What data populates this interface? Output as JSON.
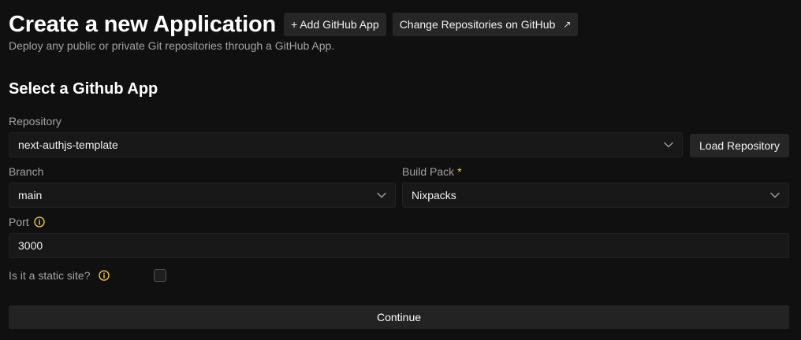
{
  "header": {
    "title": "Create a new Application",
    "add_github_app_label": "+ Add GitHub App",
    "change_repositories_label": "Change Repositories on GitHub",
    "external_link_icon": "↗",
    "subtitle": "Deploy any public or private Git repositories through a GitHub App."
  },
  "section": {
    "title": "Select a Github App"
  },
  "form": {
    "repository": {
      "label": "Repository",
      "value": "next-authjs-template"
    },
    "load_repository_label": "Load Repository",
    "branch": {
      "label": "Branch",
      "value": "main"
    },
    "build_pack": {
      "label": "Build Pack",
      "required_marker": "*",
      "value": "Nixpacks"
    },
    "port": {
      "label": "Port",
      "value": "3000"
    },
    "static_site": {
      "label": "Is it a static site?",
      "checked": false
    },
    "continue_label": "Continue"
  },
  "colors": {
    "background": "#101010",
    "input_background": "#181818",
    "button_background": "#262626",
    "info_icon": "#fcd34d",
    "required_marker": "#fcd34d",
    "label_text": "#a3a3a3"
  }
}
